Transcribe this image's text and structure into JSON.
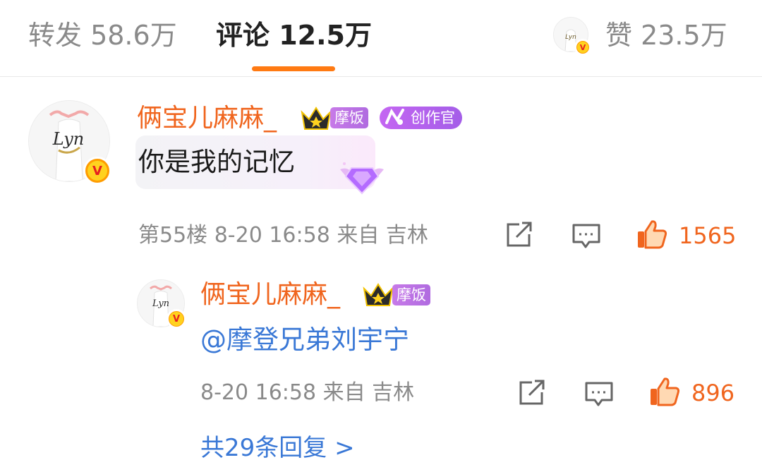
{
  "tabs": {
    "repost": "转发 58.6万",
    "comments": "评论 12.5万",
    "likes": "赞 23.5万"
  },
  "comment": {
    "username": "俩宝儿麻麻_",
    "fan_badge": "摩饭",
    "creator_badge": "创作官",
    "text": "你是我的记忆",
    "meta": "第55楼 8-20 16:58 来自 吉林",
    "like_count": "1565"
  },
  "reply": {
    "username": "俩宝儿麻麻_",
    "fan_badge": "摩饭",
    "text": "@摩登兄弟刘宇宁",
    "meta": "8-20 16:58 来自 吉林",
    "like_count": "896"
  },
  "more_replies": "共29条回复 >",
  "icons": {
    "share": "share-icon",
    "comment": "comment-icon",
    "like": "thumbs-up-icon",
    "crown": "crown-icon",
    "verified": "verified-v-icon",
    "gem": "diamond-wings-icon"
  },
  "colors": {
    "accent": "#f0651e",
    "tab_indicator": "#ff7a12",
    "link": "#3a78d6",
    "badge_purple": "#b06be0",
    "muted": "#8a8a8a"
  }
}
